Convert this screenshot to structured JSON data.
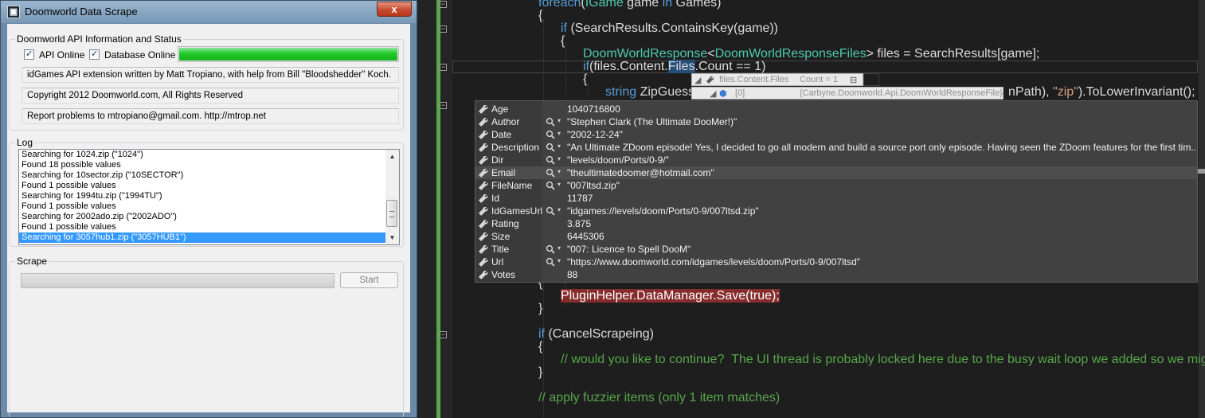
{
  "window": {
    "title": "Doomworld Data Scrape",
    "close_glyph": "x"
  },
  "api_group": {
    "label": "Doomworld API Information and Status",
    "api_online_label": "API Online",
    "database_online_label": "Database Online",
    "api_online_checked": true,
    "database_online_checked": true,
    "status_level": 1.0,
    "credits": "idGames API extension written by Matt Tropiano, with help from Bill \"Bloodshedder\" Koch.",
    "copyright": "Copyright 2012 Doomworld.com, All Rights Reserved",
    "report": "Report problems to mtropiano@gmail.com. http://mtrop.net"
  },
  "log_group": {
    "label": "Log",
    "entries": [
      "Searching for 1024.zip (\"1024\")",
      "Found 18 possible values",
      "Searching for 10sector.zip (\"10SECTOR\")",
      "Found 1 possible values",
      "Searching for 1994tu.zip (\"1994TU\")",
      "Found 1 possible values",
      "Searching for 2002ado.zip (\"2002ADO\")",
      "Found 1 possible values",
      "Searching for 3057hub1.zip (\"3057HUB1\")"
    ],
    "selected_index": 8
  },
  "scrape_group": {
    "label": "Scrape",
    "start_label": "Start",
    "progress": 0
  },
  "code": {
    "l1_kw": "foreach",
    "l1_a": "(",
    "l1_ty": "IGame",
    "l1_b": " game ",
    "l1_kw2": "in",
    "l1_c": " Games)",
    "l2": "{",
    "l3_kw": "if",
    "l3_a": " (SearchResults.ContainsKey(game))",
    "l4": "{",
    "l5_ty1": "DoomWorldResponse",
    "l5_a": "<",
    "l5_ty2": "DoomWorldResponseFiles",
    "l5_b": "> files = SearchResults[game];",
    "l6_kw": "if",
    "l6_a": "(files.Content.",
    "l6_hl": "Files",
    "l6_b": ".Count == 1)",
    "l7": "{",
    "l8_kw": "string",
    "l8_a": " ZipGuess = ",
    "l8_tail_a": "nPath), ",
    "l8_tail_st": "\"zip\"",
    "l8_tail_b": ").ToLowerInvariant();",
    "l9": "{",
    "l10_err": "PluginHelper.DataManager.Save(true);",
    "l11": "}",
    "l12_kw": "if",
    "l12_a": " (CancelScrapeing)",
    "l13": "{",
    "l14_cm": "// would you like to continue?  The UI thread is probably locked here due to the busy wait loop we added so we might",
    "l15": "}",
    "l16_cm": "// apply fuzzier items (only 1 item matches)"
  },
  "datatip": {
    "expr": "files.Content.Files",
    "count": "Count = 1",
    "child_index": "[0]",
    "child_type": "{Carbyne.Doomworld.Api.DoomWorldResponseFile}"
  },
  "properties": [
    {
      "name": "Age",
      "value": "1040716800",
      "searchable": false
    },
    {
      "name": "Author",
      "value": "\"Stephen Clark (The Ultimate DooMer!)\"",
      "searchable": true
    },
    {
      "name": "Date",
      "value": "\"2002-12-24\"",
      "searchable": true
    },
    {
      "name": "Description",
      "value": "\"An Ultimate ZDoom episode! Yes, I decided to go all modern and build a source port only episode. Having seen the ZDoom features for the first tim...",
      "searchable": true
    },
    {
      "name": "Dir",
      "value": "\"levels/doom/Ports/0-9/\"",
      "searchable": true
    },
    {
      "name": "Email",
      "value": "\"theultimatedoomer@hotmail.com\"",
      "searchable": true
    },
    {
      "name": "FileName",
      "value": "\"007ltsd.zip\"",
      "searchable": true
    },
    {
      "name": "Id",
      "value": "11787",
      "searchable": false
    },
    {
      "name": "IdGamesUrl",
      "value": "\"idgames://levels/doom/Ports/0-9/007ltsd.zip\"",
      "searchable": true
    },
    {
      "name": "Rating",
      "value": "3.875",
      "searchable": false
    },
    {
      "name": "Size",
      "value": "6445306",
      "searchable": false
    },
    {
      "name": "Title",
      "value": "\"007: Licence to Spell DooM\"",
      "searchable": true
    },
    {
      "name": "Url",
      "value": "\"https://www.doomworld.com/idgames/levels/doom/Ports/0-9/007ltsd\"",
      "searchable": true
    },
    {
      "name": "Votes",
      "value": "88",
      "searchable": false
    }
  ],
  "properties_selected_index": 5,
  "colors": {
    "keyword": "#569cd6",
    "type": "#4ec9b0",
    "string": "#d69d85",
    "comment": "#57a64a",
    "error_highlight": "#872c2c",
    "progress_green": "#21c92a",
    "selection_blue": "#3399ff"
  },
  "icons": {
    "property": "wrench-icon",
    "search": "magnifier-icon",
    "expand": "triangle-icon",
    "object": "cube-icon"
  }
}
